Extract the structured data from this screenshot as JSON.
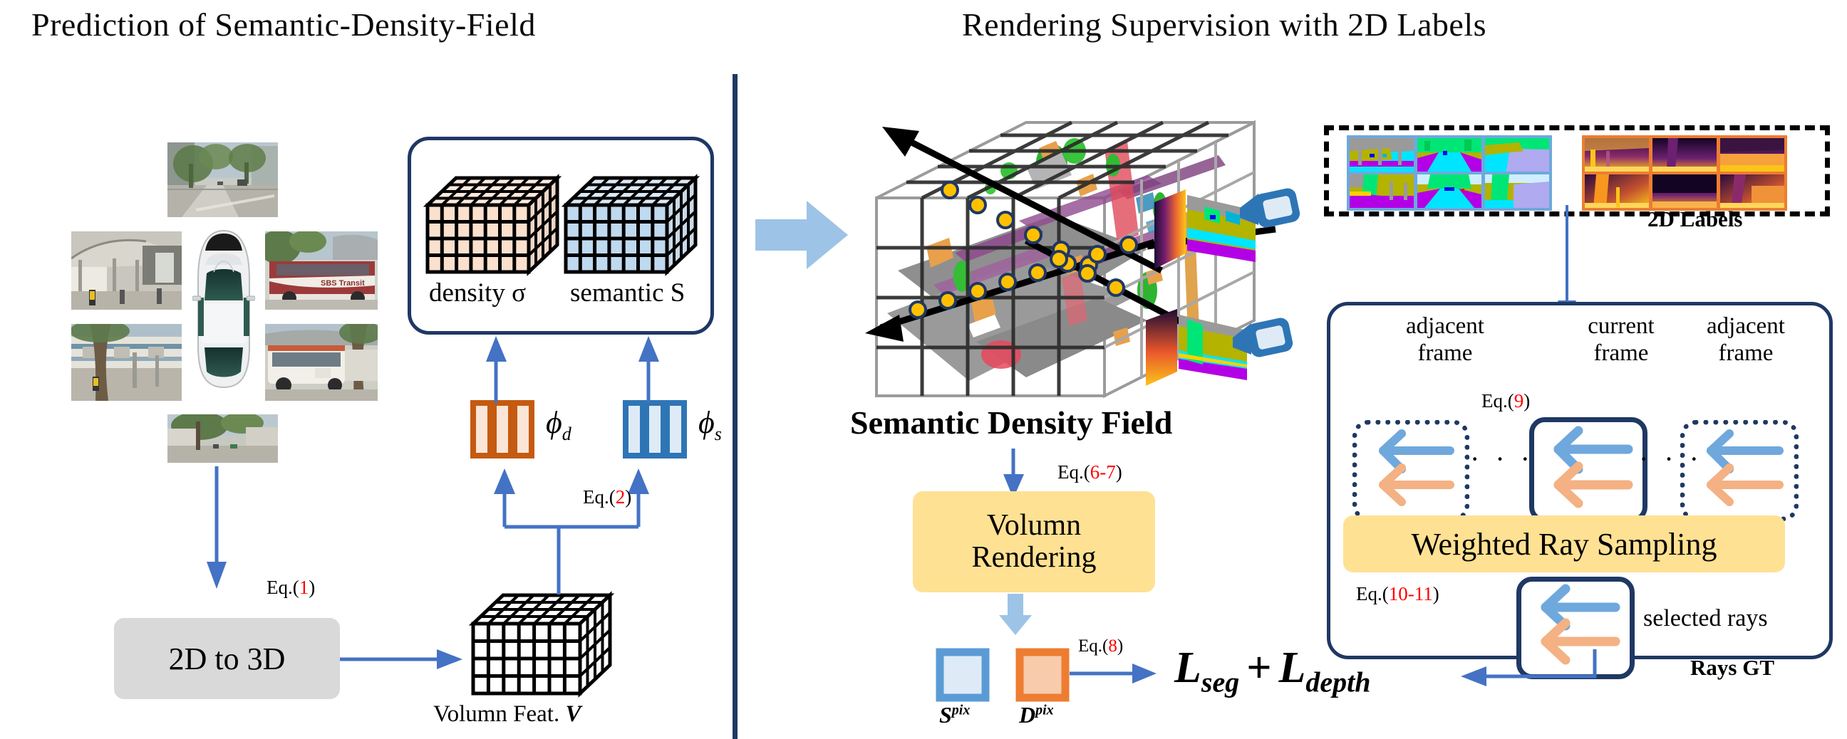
{
  "titles": {
    "left": "Prediction of  Semantic-Density-Field",
    "right": "Rendering Supervision with 2D Labels"
  },
  "left_panel": {
    "cameras_caption": "",
    "field_box": {
      "density_label": "density σ",
      "semantic_label": "semantic S"
    },
    "mlp": {
      "density_phi": "ϕ",
      "density_sub": "d",
      "semantic_phi": "ϕ",
      "semantic_sub": "s"
    },
    "eq_1": "Eq.(",
    "eq_1_num": "1",
    "eq_1_close": ")",
    "eq_2": "Eq.(",
    "eq_2_num": "2",
    "eq_2_close": ")",
    "box_2d_to_3d": "2D to 3D",
    "volume_feat_label": "Volumn Feat. ",
    "volume_feat_symbol": "V"
  },
  "center_panel": {
    "field_title": "Semantic Density Field",
    "eq_67": "Eq.(",
    "eq_67_num": "6-7",
    "eq_67_close": ")",
    "render_box_line1": "Volumn",
    "render_box_line2": "Rendering",
    "eq_8": "Eq.(",
    "eq_8_num": "8",
    "eq_8_close": ")",
    "s_pix": "S",
    "s_pix_sup": "pix",
    "d_pix": "D",
    "d_pix_sup": "pix",
    "loss_seg": "L",
    "loss_seg_sub": "seg",
    "loss_plus": "+",
    "loss_depth": "L",
    "loss_depth_sub": "depth"
  },
  "right_panel": {
    "labels_2d_caption": "2D Labels",
    "rays_gt_caption": "Rays GT",
    "adjacent_frame_left_l1": "adjacent",
    "adjacent_frame_left_l2": "frame",
    "current_frame_l1": "current",
    "current_frame_l2": "frame",
    "adjacent_frame_right_l1": "adjacent",
    "adjacent_frame_right_l2": "frame",
    "eq_9": "Eq.(",
    "eq_9_num": "9",
    "eq_9_close": ")",
    "weighted_ray_sampling": "Weighted Ray Sampling",
    "eq_1011": "Eq.(",
    "eq_1011_num": "10-11",
    "eq_1011_close": ")",
    "selected_rays": "selected rays",
    "ellipsis_left": "· · ·",
    "ellipsis_right": "· · ·"
  },
  "colors": {
    "navy": "#1f3864",
    "arrow_blue": "#4472c4",
    "light_block_arrow": "#9dc3e6",
    "orange_mlp": "#c55a11",
    "orange_fill": "#fbe5d6",
    "blue_mlp": "#2e75b6",
    "blue_fill": "#deebf7",
    "yellow_box": "#ffe193",
    "grey_box": "#d9d9d9",
    "red": "#ff0000",
    "ray_blue": "#6fa8dc",
    "ray_orange": "#f4b183",
    "sample_dot": "#ffc000",
    "seg_border": "#6fa8dc",
    "depth_border": "#ed7d31"
  }
}
